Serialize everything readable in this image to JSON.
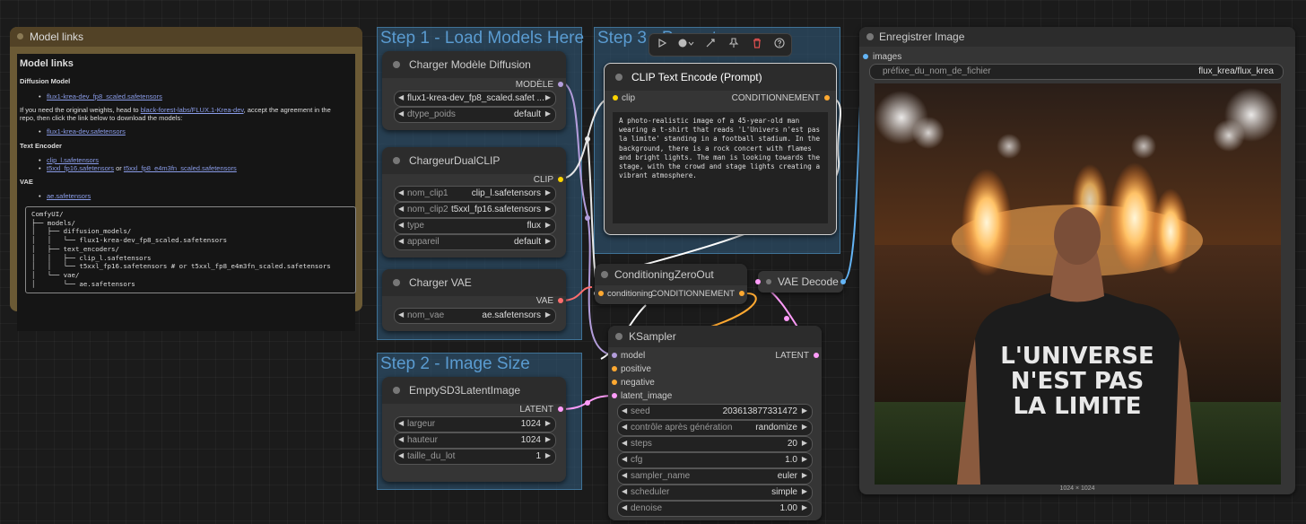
{
  "groups": {
    "step1": "Step 1 - Load Models Here",
    "step2": "Step 2 - Image Size",
    "step3": "Step 3 - Prompt"
  },
  "note": {
    "title": "Model links",
    "heading": "Model links",
    "diffusion_heading": "Diffusion Model",
    "diffusion_link": "flux1-krea-dev_fp8_scaled.safetensors",
    "weights_text_1": "If you need the original weights, head to ",
    "weights_link": "black-forest-labs/FLUX.1-Krea-dev",
    "weights_text_2": ", accept the agreement in the",
    "weights_text_3": "repo, then click the link below to download the models:",
    "weights_download_link": "flux1-krea-dev.safetensors",
    "text_encoder_heading": "Text Encoder",
    "clip_l_link": "clip_l.safetensors",
    "t5_fp16_link": "t5xxl_fp16.safetensors",
    "or_text": " or ",
    "t5_fp8_link": "t5xxl_fp8_e4m3fn_scaled.safetensors",
    "vae_heading": "VAE",
    "vae_link": "ae.safetensors",
    "tree": "ComfyUI/\n├── models/\n│   ├── diffusion_models/\n│   │   └── flux1-krea-dev_fp8_scaled.safetensors\n│   ├── text_encoders/\n│   │   ├── clip_l.safetensors\n│   │   └── t5xxl_fp16.safetensors # or t5xxl_fp8_e4m3fn_scaled.safetensors\n│   └── vae/\n│       └── ae.safetensors"
  },
  "unet": {
    "title": "Charger Modèle Diffusion",
    "output": "MODÈLE",
    "unet_name": "flux1-krea-dev_fp8_scaled.safet ...",
    "dtype_label": "dtype_poids",
    "dtype_value": "default"
  },
  "dualclip": {
    "title": "ChargeurDualCLIP",
    "output": "CLIP",
    "clip1_label": "nom_clip1",
    "clip1_value": "clip_l.safetensors",
    "clip2_label": "nom_clip2",
    "clip2_value": "t5xxl_fp16.safetensors",
    "type_label": "type",
    "type_value": "flux",
    "device_label": "appareil",
    "device_value": "default"
  },
  "vaeloader": {
    "title": "Charger VAE",
    "output": "VAE",
    "name_label": "nom_vae",
    "name_value": "ae.safetensors"
  },
  "latent": {
    "title": "EmptySD3LatentImage",
    "output": "LATENT",
    "width_label": "largeur",
    "width_value": "1024",
    "height_label": "hauteur",
    "height_value": "1024",
    "batch_label": "taille_du_lot",
    "batch_value": "1"
  },
  "clip_encode": {
    "title": "CLIP Text Encode (Prompt)",
    "input": "clip",
    "output": "CONDITIONNEMENT",
    "prompt": "A photo-realistic image of a 45-year-old man wearing a t-shirt that reads 'L'Univers n'est pas la limite' standing in a football stadium. In the background, there is a rock concert with flames and bright lights. The man is looking towards the stage, with the crowd and stage lights creating a vibrant atmosphere."
  },
  "cond_zero": {
    "title": "ConditioningZeroOut",
    "input": "conditioning",
    "output": "CONDITIONNEMENT"
  },
  "vae_decode": {
    "title": "VAE Decode"
  },
  "ksampler": {
    "title": "KSampler",
    "in_model": "model",
    "in_positive": "positive",
    "in_negative": "negative",
    "in_latent": "latent_image",
    "output": "LATENT",
    "seed_label": "seed",
    "seed_value": "203613877331472",
    "control_label": "contrôle après génération",
    "control_value": "randomize",
    "steps_label": "steps",
    "steps_value": "20",
    "cfg_label": "cfg",
    "cfg_value": "1.0",
    "sampler_label": "sampler_name",
    "sampler_value": "euler",
    "scheduler_label": "scheduler",
    "scheduler_value": "simple",
    "denoise_label": "denoise",
    "denoise_value": "1.00"
  },
  "save": {
    "title": "Enregistrer Image",
    "input": "images",
    "prefix_label": "préfixe_du_nom_de_fichier",
    "prefix_value": "flux_krea/flux_krea",
    "image_size": "1024 × 1024",
    "shirt_line1": "L'UNIVERSE",
    "shirt_line2": "N'EST PAS",
    "shirt_line3": "LA LIMITE"
  },
  "toolbar_icons": [
    "play-icon",
    "color-icon",
    "bypass-icon",
    "pin-icon",
    "delete-icon",
    "help-icon"
  ],
  "colors": {
    "model_wire": "#b39ddb",
    "clip_wire": "#ffd500",
    "vae_wire": "#ff6e6e",
    "latent_wire": "#ff9cf9",
    "conditioning_wire": "#ffa931",
    "image_wire": "#64b5f6",
    "group": "#335a7a",
    "note": "#6b5a35",
    "link": "#8a9ce8"
  }
}
